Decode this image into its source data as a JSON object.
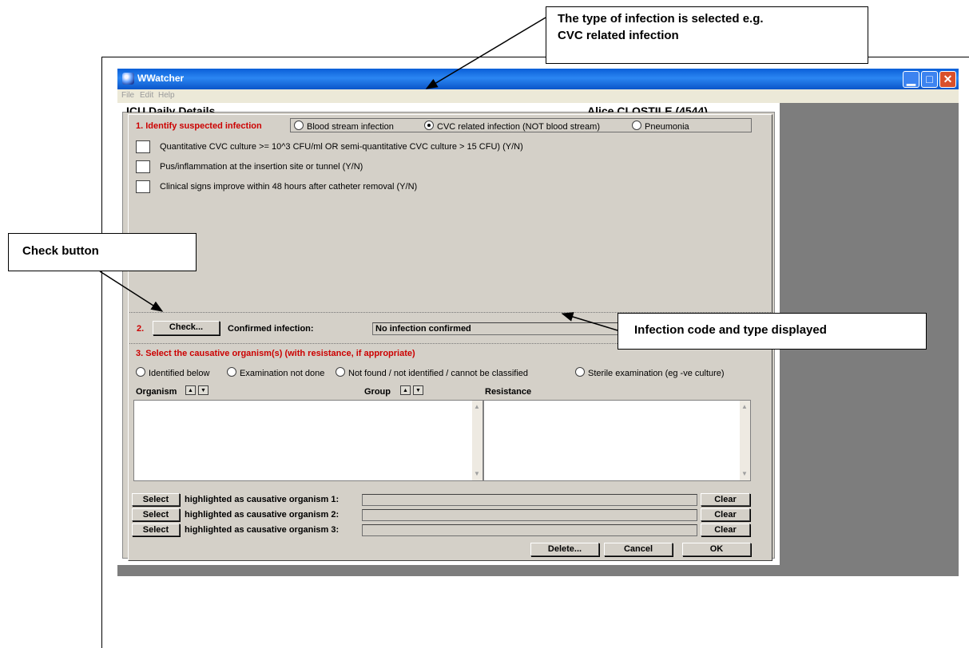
{
  "callouts": {
    "infection_type_line1": "The type of infection is selected e.g.",
    "infection_type_line2": "CVC related infection",
    "check_button": "Check button",
    "infection_code": "Infection code and type displayed"
  },
  "window": {
    "title": "WWatcher",
    "menu": [
      "File",
      "Edit",
      "Help"
    ],
    "background_title_left": "ICU Daily Details",
    "background_title_right": "Alice CLOSTILE (4544)"
  },
  "section1": {
    "label": "1. Identify suspected infection",
    "options": [
      {
        "label": "Blood stream infection",
        "selected": false
      },
      {
        "label": "CVC related infection (NOT blood stream)",
        "selected": true
      },
      {
        "label": "Pneumonia",
        "selected": false
      }
    ],
    "criteria": [
      "Quantitative CVC culture >= 10^3 CFU/ml OR semi-quantitative CVC culture > 15 CFU) (Y/N)",
      "Pus/inflammation at the insertion site or tunnel (Y/N)",
      "Clinical signs improve within 48 hours after catheter removal (Y/N)"
    ]
  },
  "section2": {
    "number": "2.",
    "check_label": "Check...",
    "confirmed_label": "Confirmed infection:",
    "confirmed_value": "No infection confirmed"
  },
  "section3": {
    "label": "3. Select the causative organism(s) (with resistance, if appropriate)",
    "options": [
      "Identified below",
      "Examination not done",
      "Not found / not identified / cannot be classified",
      "Sterile examination (eg -ve culture)"
    ],
    "col_organism": "Organism",
    "col_group": "Group",
    "col_resistance": "Resistance",
    "rows": [
      {
        "select": "Select",
        "label": "highlighted as causative organism 1:",
        "clear": "Clear"
      },
      {
        "select": "Select",
        "label": "highlighted as causative organism 2:",
        "clear": "Clear"
      },
      {
        "select": "Select",
        "label": "highlighted as causative organism 3:",
        "clear": "Clear"
      }
    ]
  },
  "buttons": {
    "delete": "Delete...",
    "cancel": "Cancel",
    "ok": "OK"
  }
}
